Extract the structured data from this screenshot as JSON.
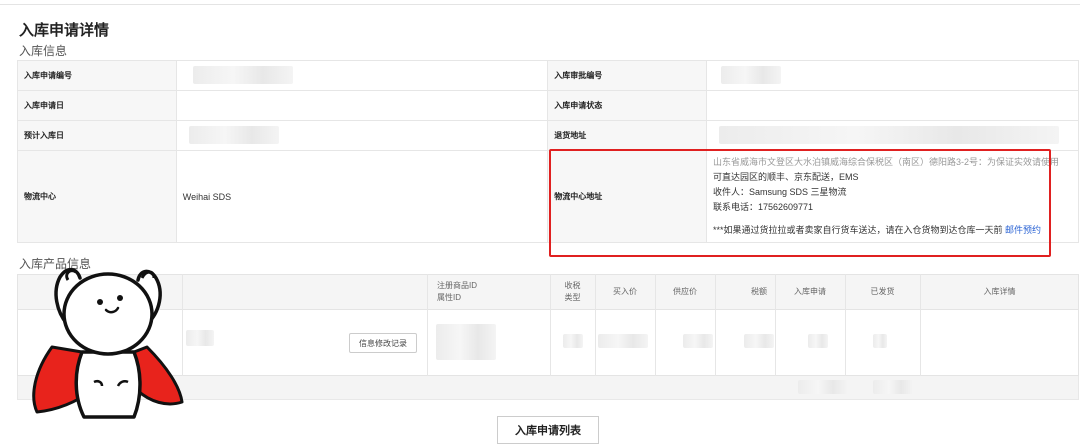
{
  "page": {
    "title": "入库申请详情",
    "section_info": "入库信息",
    "section_products": "入库产品信息"
  },
  "info": {
    "apply_no_label": "入库申请编号",
    "approval_no_label": "入库审批编号",
    "apply_date_label": "入库申请日",
    "apply_status_label": "入库申请状态",
    "expected_date_label": "预计入库日",
    "return_addr_label": "退货地址",
    "center_label": "物流中心",
    "center_value": "Weihai SDS",
    "center_addr_label": "物流中心地址",
    "address_line1": "山东省威海市文登区大水泊镇威海综合保税区（南区）德阳路3-2号：为保证实效请使用",
    "address_line2": "可直达园区的顺丰、京东配送，EMS",
    "recipient": "收件人：Samsung SDS 三星物流",
    "phone": "联系电话：17562609771",
    "notice": "***如果通过货拉拉或者卖家自行货车送达，请在入仓货物到达仓库一天前",
    "notice_link": "邮件预约"
  },
  "products": {
    "headers": {
      "reg_id": "注册商品ID",
      "attr_id": "属性ID",
      "tax_type_1": "收税",
      "tax_type_2": "类型",
      "buy_price": "买入价",
      "supply_price": "供应价",
      "tax": "税额",
      "apply": "入库申请",
      "shipped": "已发货",
      "detail": "入库详情"
    },
    "edit_button": "信息修改记录"
  },
  "footer": {
    "list_button": "入库申请列表"
  },
  "colors": {
    "highlight_box": "#e02020",
    "link": "#2a63d4",
    "sticker_cape": "#e8231c"
  },
  "icons": {
    "sticker": "cartoon-character-with-red-cape-sticker"
  }
}
